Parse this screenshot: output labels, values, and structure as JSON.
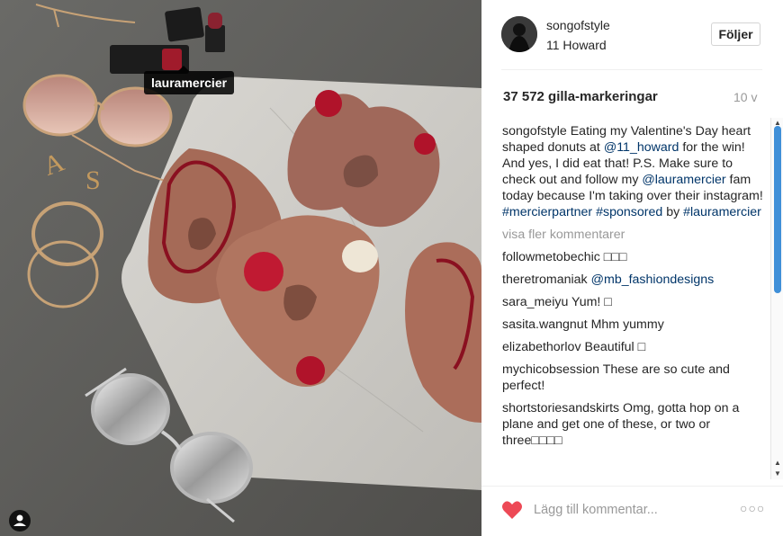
{
  "photo": {
    "tag_label": "lauramercier"
  },
  "post": {
    "username": "songofstyle",
    "location": "11 Howard",
    "follow_label": "Följer",
    "likes": "37 572 gilla-markeringar",
    "age": "10 v",
    "caption": {
      "user": "songofstyle",
      "part1": " Eating my Valentine's Day heart shaped donuts at ",
      "link1": "@11_howard",
      "part2": " for the win! And yes, I did eat that! P.S. Make sure to check out and follow my ",
      "link2": "@lauramercier",
      "part3": " fam today because I'm taking over their instagram! ",
      "link3": "#mercierpartner",
      "part4": " ",
      "link4": "#sponsored",
      "part5": " by ",
      "link5": "#lauramercier"
    },
    "more_comments": "visa fler kommentarer",
    "comments": [
      {
        "user": "followmetobechic",
        "text": " □□□",
        "link": ""
      },
      {
        "user": "theretromaniak",
        "text": " ",
        "link": "@mb_fashiondesigns"
      },
      {
        "user": "sara_meiyu",
        "text": " Yum! □",
        "link": ""
      },
      {
        "user": "sasita.wangnut",
        "text": " Mhm yummy",
        "link": ""
      },
      {
        "user": "elizabethorlov",
        "text": " Beautiful □",
        "link": ""
      },
      {
        "user": "mychicobsession",
        "text": " These are so cute and perfect!",
        "link": ""
      },
      {
        "user": "shortstoriesandskirts",
        "text": " Omg, gotta hop on a plane and get one of these, or two or three□□□□",
        "link": ""
      }
    ],
    "comment_placeholder": "Lägg till kommentar...",
    "more_options": "○○○"
  },
  "colors": {
    "link": "#003569",
    "heart": "#ed4956",
    "scroll_thumb": "#3f8fd8"
  }
}
